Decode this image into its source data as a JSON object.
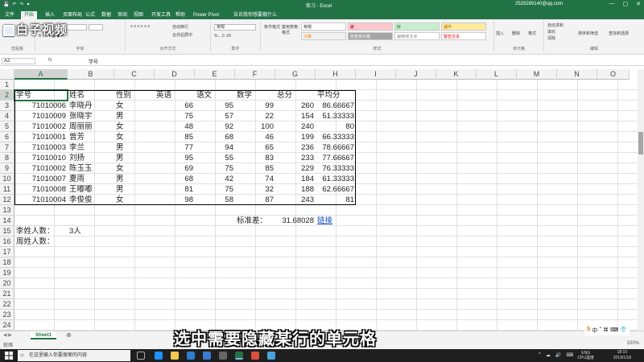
{
  "window": {
    "title": "练习 - Excel",
    "account": "2529289140@qq.com",
    "quick_access": [
      "💾",
      "↶",
      "↷",
      "▾"
    ],
    "controls": [
      "—",
      "▢",
      "✕"
    ]
  },
  "tabs": [
    "文件",
    "开始",
    "插入",
    "页面布局",
    "公式",
    "数据",
    "审阅",
    "视图",
    "开发工具",
    "帮助",
    "Power Pivot",
    "告诉我你想要做什么"
  ],
  "active_tab_index": 1,
  "ribbon": {
    "groups": [
      "剪贴板",
      "字体",
      "对齐方式",
      "数字",
      "样式",
      "单元格",
      "编辑"
    ],
    "number_format": "常规",
    "styles": [
      "常规",
      "差",
      "好",
      "适中",
      "计算",
      "检查单元格",
      "解释性文本",
      "警告文本",
      "链接单元格"
    ],
    "cells_buttons": [
      "插入",
      "删除",
      "格式"
    ],
    "edit_buttons": [
      "自动求和",
      "填充",
      "清除",
      "排序和筛选",
      "查找和选择"
    ],
    "misc": [
      "条件格式",
      "套用表格格式",
      "合并后居中",
      "自动换行"
    ]
  },
  "logo": {
    "text": "白子视频"
  },
  "formula_bar": {
    "name_box": "A2",
    "fx": "fx",
    "content": "学号"
  },
  "columns": [
    "A",
    "B",
    "C",
    "D",
    "E",
    "F",
    "G",
    "H",
    "I",
    "J",
    "K",
    "L",
    "M",
    "N",
    "O"
  ],
  "rows": [
    "1",
    "2",
    "3",
    "4",
    "5",
    "6",
    "7",
    "8",
    "9",
    "10",
    "11",
    "12",
    "13",
    "14",
    "15",
    "16",
    "17",
    "18",
    "19",
    "20",
    "21",
    "22",
    "23",
    "24"
  ],
  "table": {
    "headers": [
      "学号",
      "姓名",
      "性别",
      "英语",
      "语文",
      "数学",
      "总分",
      "平均分"
    ],
    "records": [
      [
        "71010006",
        "李晓丹",
        "女",
        "66",
        "95",
        "99",
        "260",
        "86.66667"
      ],
      [
        "71010009",
        "张晓宇",
        "男",
        "75",
        "57",
        "22",
        "154",
        "51.33333"
      ],
      [
        "71010002",
        "周丽丽",
        "女",
        "48",
        "92",
        "100",
        "240",
        "80"
      ],
      [
        "71010001",
        "曾芳",
        "女",
        "85",
        "68",
        "46",
        "199",
        "66.33333"
      ],
      [
        "71010003",
        "李兰",
        "男",
        "77",
        "94",
        "65",
        "236",
        "78.66667"
      ],
      [
        "71010010",
        "刘扬",
        "男",
        "95",
        "55",
        "83",
        "233",
        "77.66667"
      ],
      [
        "71010002",
        "陈玉玉",
        "女",
        "69",
        "75",
        "85",
        "229",
        "76.33333"
      ],
      [
        "71010007",
        "夏雨",
        "男",
        "68",
        "42",
        "74",
        "184",
        "61.33333"
      ],
      [
        "71010008",
        "王嘟嘟",
        "男",
        "81",
        "75",
        "32",
        "188",
        "62.66667"
      ],
      [
        "71010004",
        "李俊俊",
        "女",
        "98",
        "58",
        "87",
        "243",
        "81"
      ]
    ]
  },
  "extras": {
    "std_label": "标准差：",
    "std_value": "31.68028",
    "std_link": "链接",
    "li_label": "李姓人数：",
    "li_value": "3人",
    "zhou_label": "周姓人数："
  },
  "sheet": {
    "tab": "Sheet1",
    "add": "⊕",
    "nav": "◀ ▶"
  },
  "status": {
    "ready": "就绪",
    "zoom": "100%"
  },
  "subtitle": "选中需要隐藏某行的单元格",
  "taskbar": {
    "search_placeholder": "在这里输入你要搜索的内容",
    "tray": [
      "^",
      "☁",
      "🔊",
      "⌨"
    ],
    "lang": "ENG",
    "lang_sub": "CPU温度",
    "time": "18:10",
    "date": "2019/1/18"
  },
  "watermark_icons": [
    "S",
    "中",
    "°",
    "⌘",
    "⌨",
    "👕"
  ]
}
